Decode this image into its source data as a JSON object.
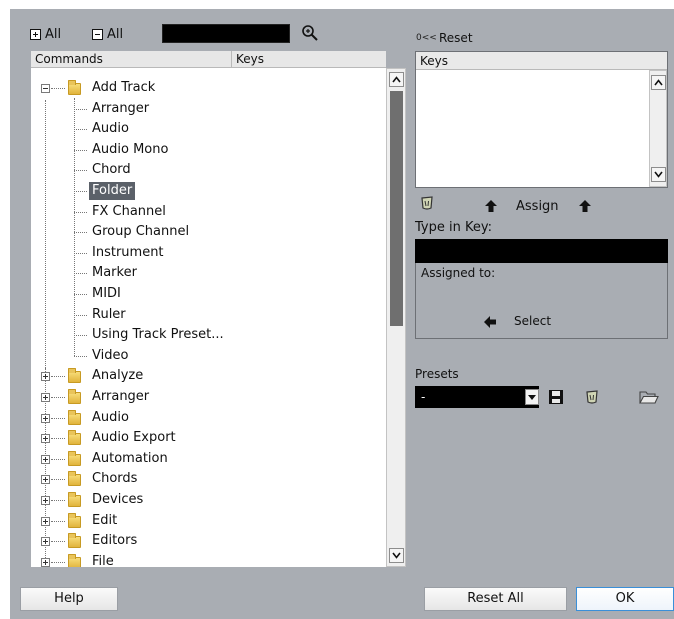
{
  "toolbar": {
    "expand_all_label": "All",
    "collapse_all_label": "All",
    "search_value": ""
  },
  "commands_list": {
    "col_commands": "Commands",
    "col_keys": "Keys",
    "items": [
      {
        "label": "Add Track",
        "type": "folder",
        "expanded": true
      },
      {
        "label": "Arranger",
        "type": "child"
      },
      {
        "label": "Audio",
        "type": "child"
      },
      {
        "label": "Audio Mono",
        "type": "child"
      },
      {
        "label": "Chord",
        "type": "child"
      },
      {
        "label": "Folder",
        "type": "child",
        "selected": true
      },
      {
        "label": "FX Channel",
        "type": "child"
      },
      {
        "label": "Group Channel",
        "type": "child"
      },
      {
        "label": "Instrument",
        "type": "child"
      },
      {
        "label": "Marker",
        "type": "child"
      },
      {
        "label": "MIDI",
        "type": "child"
      },
      {
        "label": "Ruler",
        "type": "child"
      },
      {
        "label": "Using Track Preset...",
        "type": "child"
      },
      {
        "label": "Video",
        "type": "child"
      },
      {
        "label": "Analyze",
        "type": "folder",
        "expanded": false
      },
      {
        "label": "Arranger",
        "type": "folder",
        "expanded": false
      },
      {
        "label": "Audio",
        "type": "folder",
        "expanded": false
      },
      {
        "label": "Audio Export",
        "type": "folder",
        "expanded": false
      },
      {
        "label": "Automation",
        "type": "folder",
        "expanded": false
      },
      {
        "label": "Chords",
        "type": "folder",
        "expanded": false
      },
      {
        "label": "Devices",
        "type": "folder",
        "expanded": false
      },
      {
        "label": "Edit",
        "type": "folder",
        "expanded": false
      },
      {
        "label": "Editors",
        "type": "folder",
        "expanded": false
      },
      {
        "label": "File",
        "type": "folder",
        "expanded": false
      }
    ]
  },
  "right_panel": {
    "reset_icon_text": "0<<",
    "reset_label": "Reset",
    "keys_header": "Keys",
    "assign_label": "Assign",
    "type_in_key_label": "Type in Key:",
    "type_in_key_value": "",
    "assigned_to_label": "Assigned to:",
    "select_label": "Select"
  },
  "presets": {
    "label": "Presets",
    "selected": "-"
  },
  "footer": {
    "help_label": "Help",
    "reset_all_label": "Reset All",
    "ok_label": "OK"
  },
  "colors": {
    "dialog_bg": "#a9adb3",
    "selection_bg": "#5b6169",
    "scroll_thumb": "#6f6f6f"
  }
}
